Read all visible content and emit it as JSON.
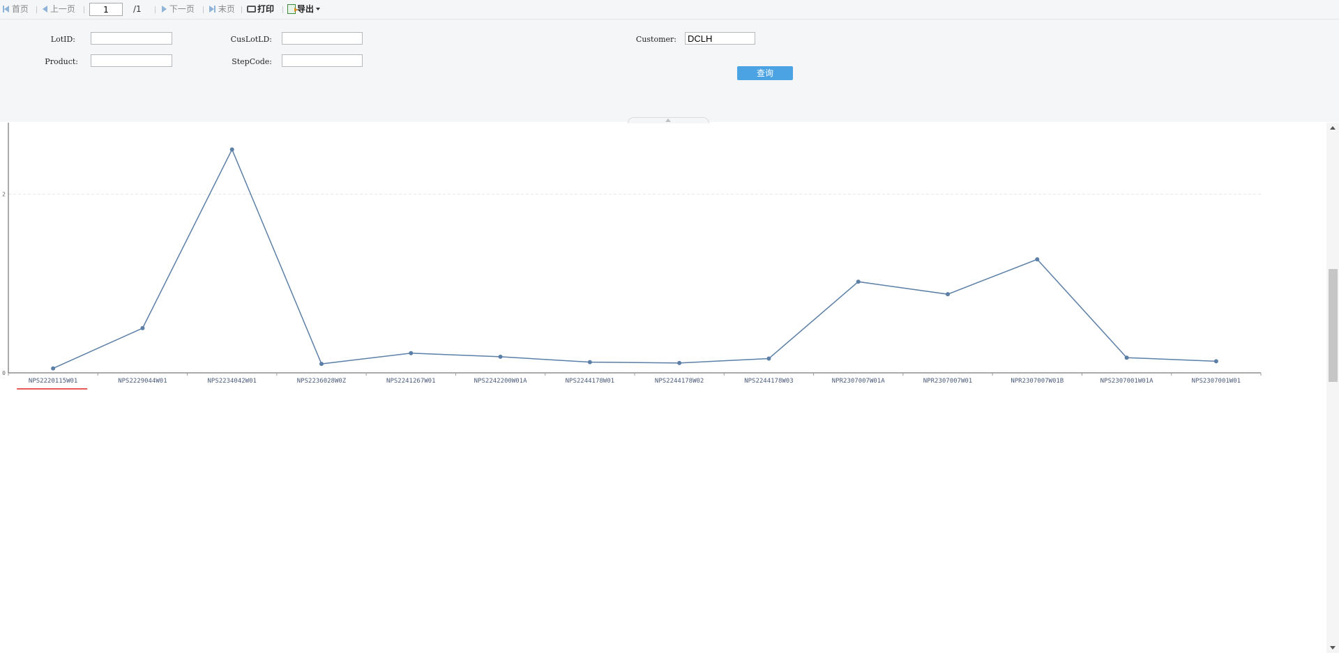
{
  "toolbar": {
    "first_label": "首页",
    "prev_label": "上一页",
    "page_value": "1",
    "page_total": "/1",
    "next_label": "下一页",
    "last_label": "末页",
    "print_label": "打印",
    "export_label": "导出"
  },
  "form": {
    "lotid_label": "LotID:",
    "cuslotid_label": "CusLotLD:",
    "customer_label": "Customer:",
    "product_label": "Product:",
    "stepcode_label": "StepCode:",
    "lotid_value": "",
    "cuslotid_value": "",
    "customer_value": "DCLH",
    "product_value": "",
    "stepcode_value": "",
    "query_label": "查询"
  },
  "chart_data": {
    "type": "line",
    "categories": [
      "NPS2220115W01",
      "NPS2229044W01",
      "NPS2234042W01",
      "NPS2236028W0Z",
      "NPS2241267W01",
      "NPS2242200W01A",
      "NPS2244178W01",
      "NPS2244178W02",
      "NPS2244178W03",
      "NPR2307007W01A",
      "NPR2307007W01",
      "NPR2307007W01B",
      "NPS2307001W01A",
      "NPS2307001W01"
    ],
    "series": [
      {
        "values": [
          0.05,
          0.5,
          2.5,
          0.1,
          0.22,
          0.18,
          0.12,
          0.11,
          0.16,
          1.02,
          0.88,
          1.27,
          0.17,
          0.13
        ]
      }
    ],
    "yticks": [
      "0",
      "2"
    ],
    "ylim": [
      0,
      2.8
    ],
    "grid": "dashed at 2",
    "colors": {
      "line": "#5b7fa6",
      "axis": "#555555",
      "grid": "#e6e6e6",
      "highlight": "#e02020"
    }
  }
}
